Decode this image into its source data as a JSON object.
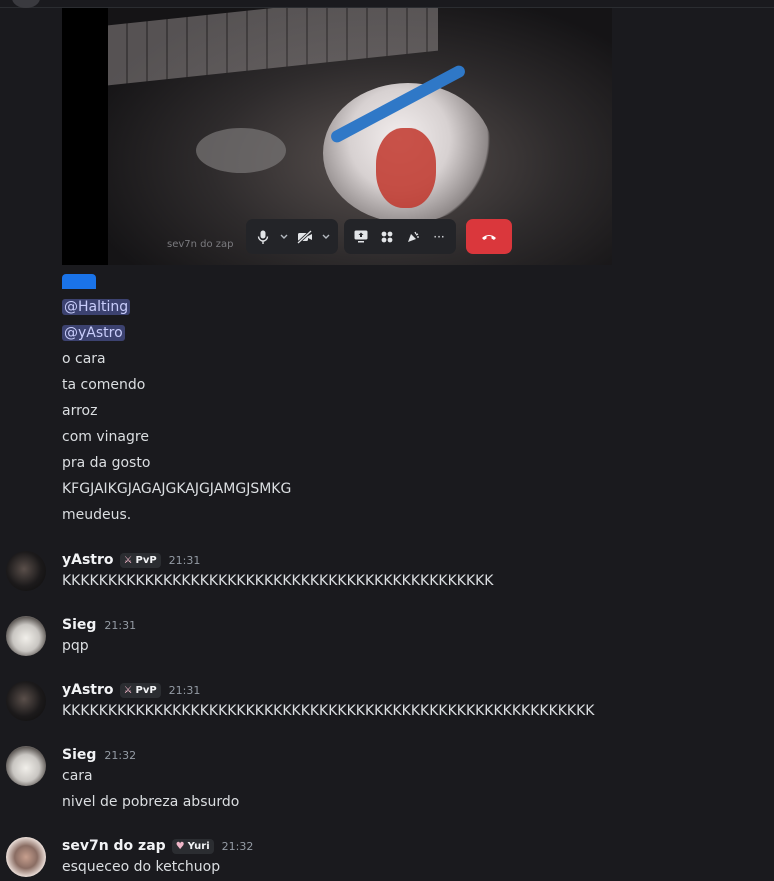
{
  "video": {
    "watermark": "sev7n do zap",
    "controls": {
      "mic_icon": "microphone-icon",
      "camera_icon": "camera-off-icon",
      "screenshare_icon": "screen-share-icon",
      "activities_icon": "activities-icon",
      "soundboard_icon": "soundboard-icon",
      "more_icon": "more-icon",
      "more_label": "···",
      "hangup_icon": "hang-up-icon",
      "hangup_color": "#da373c"
    }
  },
  "continued_message": {
    "mention1": "@Halting",
    "mention2": "@yAstro",
    "lines": [
      "o cara",
      "ta comendo",
      "arroz",
      "com vinagre",
      "pra da gosto",
      "KFGJAIKGJAGAJGKAJGJAMGJSMKG",
      "meudeus."
    ]
  },
  "messages": [
    {
      "username": "yAstro",
      "tag": "PvP",
      "tag_icon": "crossed-swords-icon",
      "time": "21:31",
      "lines": [
        "KKKKKKKKKKKKKKKKKKKKKKKKKKKKKKKKKKKKKKKKKKKKKKK"
      ]
    },
    {
      "username": "Sieg",
      "time": "21:31",
      "lines": [
        "pqp"
      ]
    },
    {
      "username": "yAstro",
      "tag": "PvP",
      "tag_icon": "crossed-swords-icon",
      "time": "21:31",
      "lines": [
        "KKKKKKKKKKKKKKKKKKKKKKKKKKKKKKKKKKKKKKKKKKKKKKKKKKKKKKKKKK"
      ]
    },
    {
      "username": "Sieg",
      "time": "21:32",
      "lines": [
        "cara",
        "nivel de pobreza absurdo"
      ]
    },
    {
      "username": "sev7n do zap",
      "tag": "Yuri",
      "tag_icon": "heart-icon",
      "time": "21:32",
      "lines": [
        "esqueceo do ketchuop"
      ]
    }
  ],
  "colors": {
    "mention_bg": "#3c4270",
    "background": "#1a1a1e",
    "accent_blue": "#1a73e8"
  }
}
